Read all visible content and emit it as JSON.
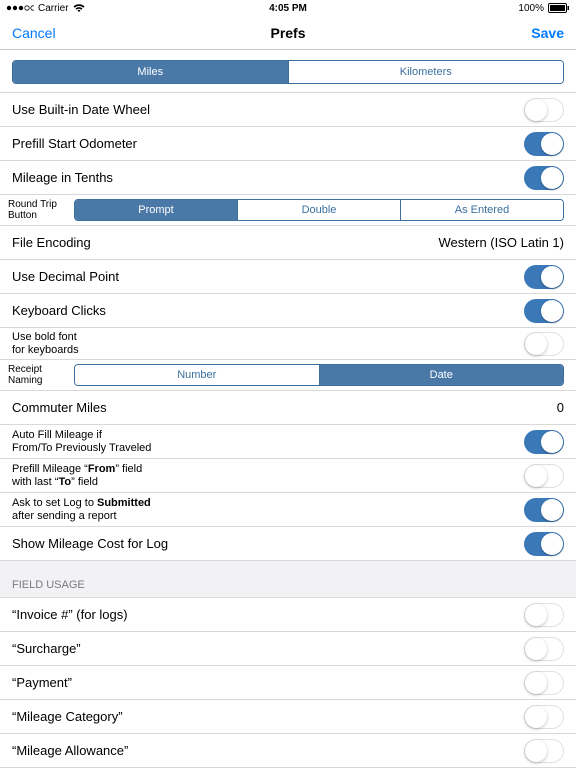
{
  "status": {
    "carrier": "Carrier",
    "time": "4:05 PM",
    "batteryText": "100%"
  },
  "nav": {
    "cancel": "Cancel",
    "title": "Prefs",
    "save": "Save"
  },
  "units": {
    "miles": "Miles",
    "kilometers": "Kilometers"
  },
  "rows": {
    "useBuiltInDateWheel": "Use Built-in Date Wheel",
    "prefillStartOdometer": "Prefill Start Odometer",
    "mileageInTenths": "Mileage in Tenths",
    "roundTripLabel": "Round Trip\nButton",
    "roundTrip": {
      "prompt": "Prompt",
      "double": "Double",
      "asEntered": "As Entered"
    },
    "fileEncoding": "File Encoding",
    "fileEncodingValue": "Western (ISO Latin 1)",
    "useDecimalPoint": "Use Decimal Point",
    "keyboardClicks": "Keyboard Clicks",
    "boldFontKeyboards": "Use bold font\nfor keyboards",
    "receiptNamingLabel": "Receipt\nNaming",
    "receiptNaming": {
      "number": "Number",
      "date": "Date"
    },
    "commuterMiles": "Commuter Miles",
    "commuterValue": "0",
    "autoFillMileage": "Auto Fill Mileage if\nFrom/To Previously Traveled",
    "prefillFromTo": "Prefill Mileage “From” field\nwith last “To” field",
    "askSubmitted": "Ask to set Log to Submitted\nafter sending a report",
    "showMileageCost": "Show Mileage Cost for Log"
  },
  "sectionFieldUsage": "FIELD USAGE",
  "fields": {
    "invoice": "“Invoice #” (for logs)",
    "surcharge": "“Surcharge”",
    "payment": "“Payment”",
    "mileageCategory": "“Mileage Category”",
    "mileageAllowance": "“Mileage Allowance”"
  }
}
